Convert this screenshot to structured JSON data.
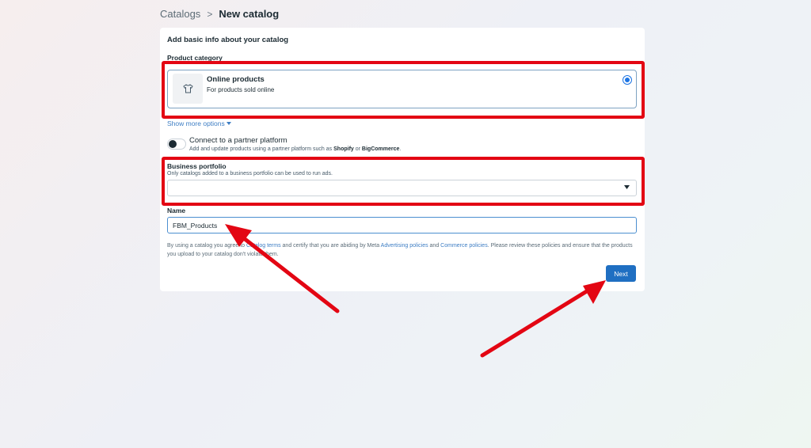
{
  "breadcrumb": {
    "parent": "Catalogs",
    "separator": ">",
    "current": "New catalog"
  },
  "form": {
    "section_title": "Add basic info about your catalog",
    "product_category": {
      "label": "Product category",
      "option_title": "Online products",
      "option_description": "For products sold online",
      "icon": "tshirt-icon",
      "selected": true
    },
    "show_more": "Show more options",
    "partner": {
      "title": "Connect to a partner platform",
      "description_prefix": "Add and update products using a partner platform such as ",
      "brand_1": "Shopify",
      "conjunction": " or ",
      "brand_2": "BigCommerce",
      "suffix": ".",
      "enabled": false
    },
    "business_portfolio": {
      "label": "Business portfolio",
      "helper": "Only catalogs added to a business portfolio can be used to run ads.",
      "value": ""
    },
    "name": {
      "label": "Name",
      "value": "FBM_Products"
    },
    "terms": {
      "part1": "By using a catalog you agree to ",
      "link1": "Catalog terms",
      "part2": " and certify that you are abiding by Meta ",
      "link2": "Advertising policies",
      "part3": " and ",
      "link3": "Commerce policies",
      "part4": ". Please review these policies and ensure that the products you upload to your catalog don't violate them."
    },
    "next_label": "Next"
  },
  "colors": {
    "accent": "#1f6fc2",
    "link": "#3e7ec4",
    "annotation": "#e30613"
  }
}
